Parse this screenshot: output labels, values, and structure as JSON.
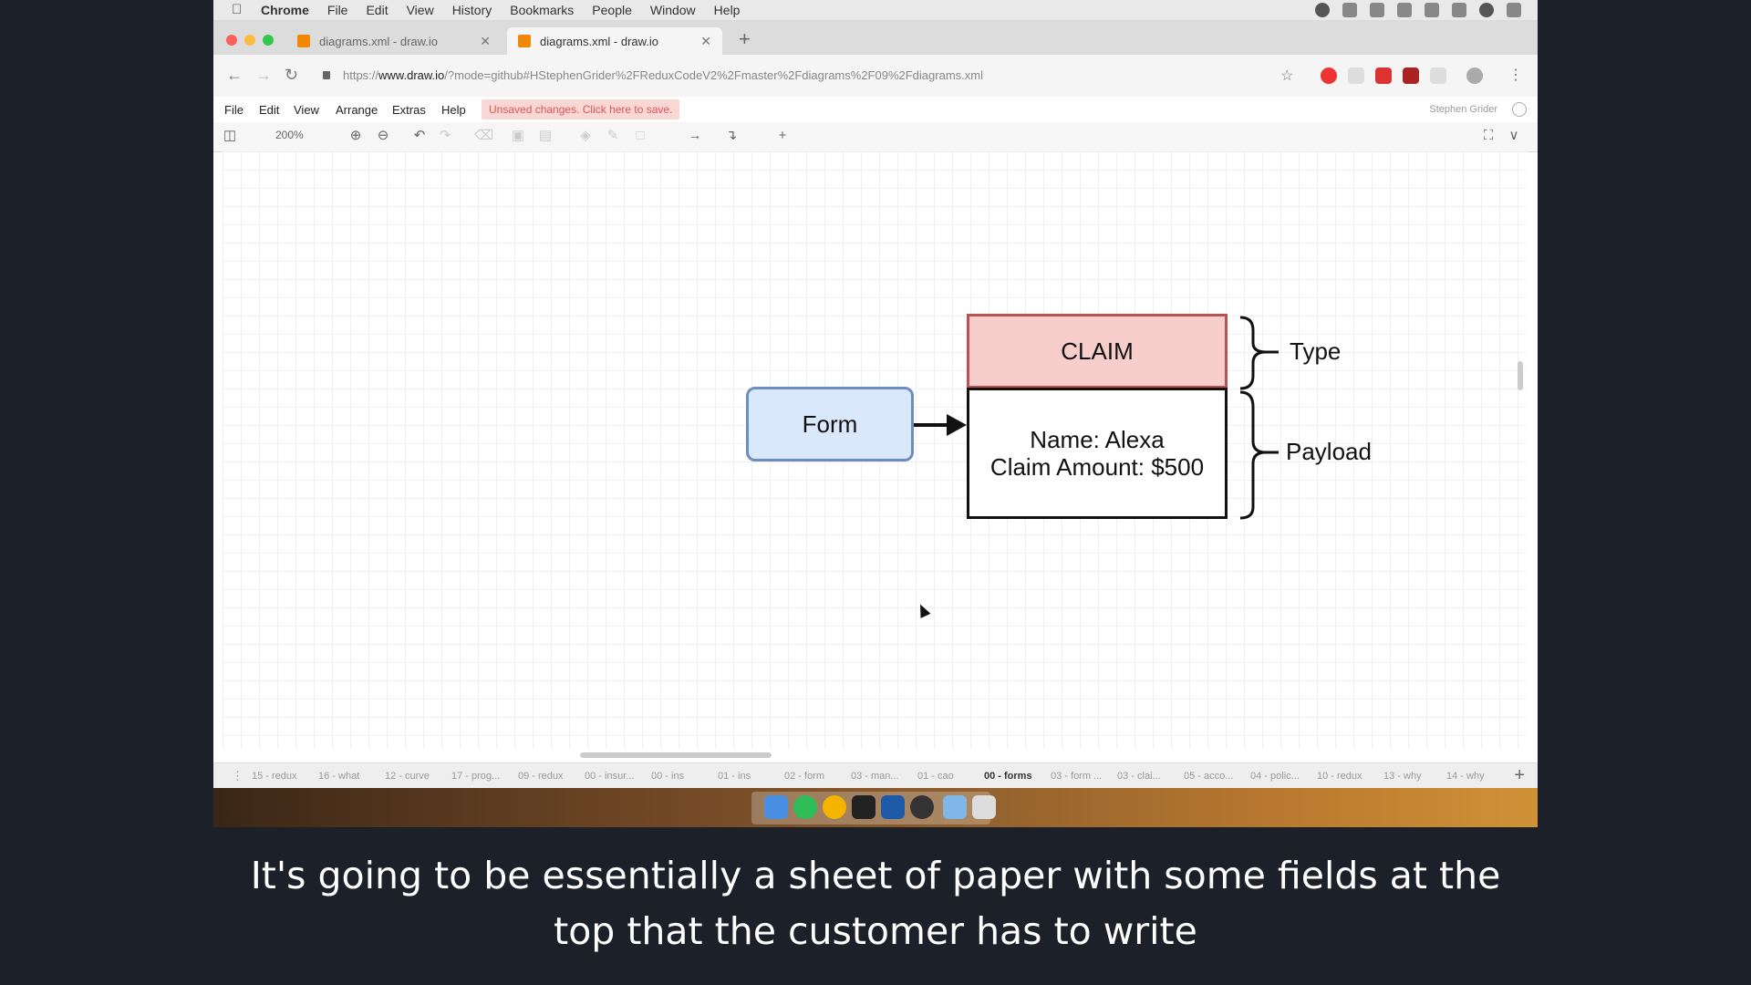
{
  "menubar": {
    "app": "Chrome",
    "items": [
      "File",
      "Edit",
      "View",
      "History",
      "Bookmarks",
      "People",
      "Window",
      "Help"
    ]
  },
  "tabs": [
    {
      "title": "diagrams.xml - draw.io",
      "active": false
    },
    {
      "title": "diagrams.xml - draw.io",
      "active": true
    }
  ],
  "address": {
    "scheme": "https://",
    "host": "www.draw.io",
    "path": "/?mode=github#HStephenGrider%2FReduxCodeV2%2Fmaster%2Fdiagrams%2F09%2Fdiagrams.xml"
  },
  "app_menu": {
    "items": [
      "File",
      "Edit",
      "View",
      "Arrange",
      "Extras",
      "Help"
    ],
    "unsaved": "Unsaved changes. Click here to save.",
    "user": "Stephen Grider"
  },
  "toolbar": {
    "zoom": "200%"
  },
  "diagram": {
    "form_label": "Form",
    "claim_type": "CLAIM",
    "payload_line1": "Name: Alexa",
    "payload_line2": "Claim Amount: $500",
    "type_label": "Type",
    "payload_label": "Payload"
  },
  "page_tabs": [
    "15 - redux",
    "16 - what",
    "12 - curve",
    "17 - prog...",
    "09 - redux",
    "00 - insur...",
    "00 - ins",
    "01 - ins",
    "02 - form",
    "03 - man...",
    "01 - cao",
    "00 - forms",
    "03 - form ...",
    "03 - clai...",
    "05 - acco...",
    "04 - polic...",
    "10 - redux",
    "13 - why",
    "14 - why"
  ],
  "active_page_tab": "00 - forms",
  "caption": {
    "line1": "It's going to be essentially a sheet of paper with some fields at the",
    "line2": "top that the customer has to write"
  },
  "colors": {
    "form_fill": "#dae8fc",
    "form_stroke": "#6c8ebf",
    "claim_fill": "#f8cecc",
    "claim_stroke": "#b85450"
  }
}
